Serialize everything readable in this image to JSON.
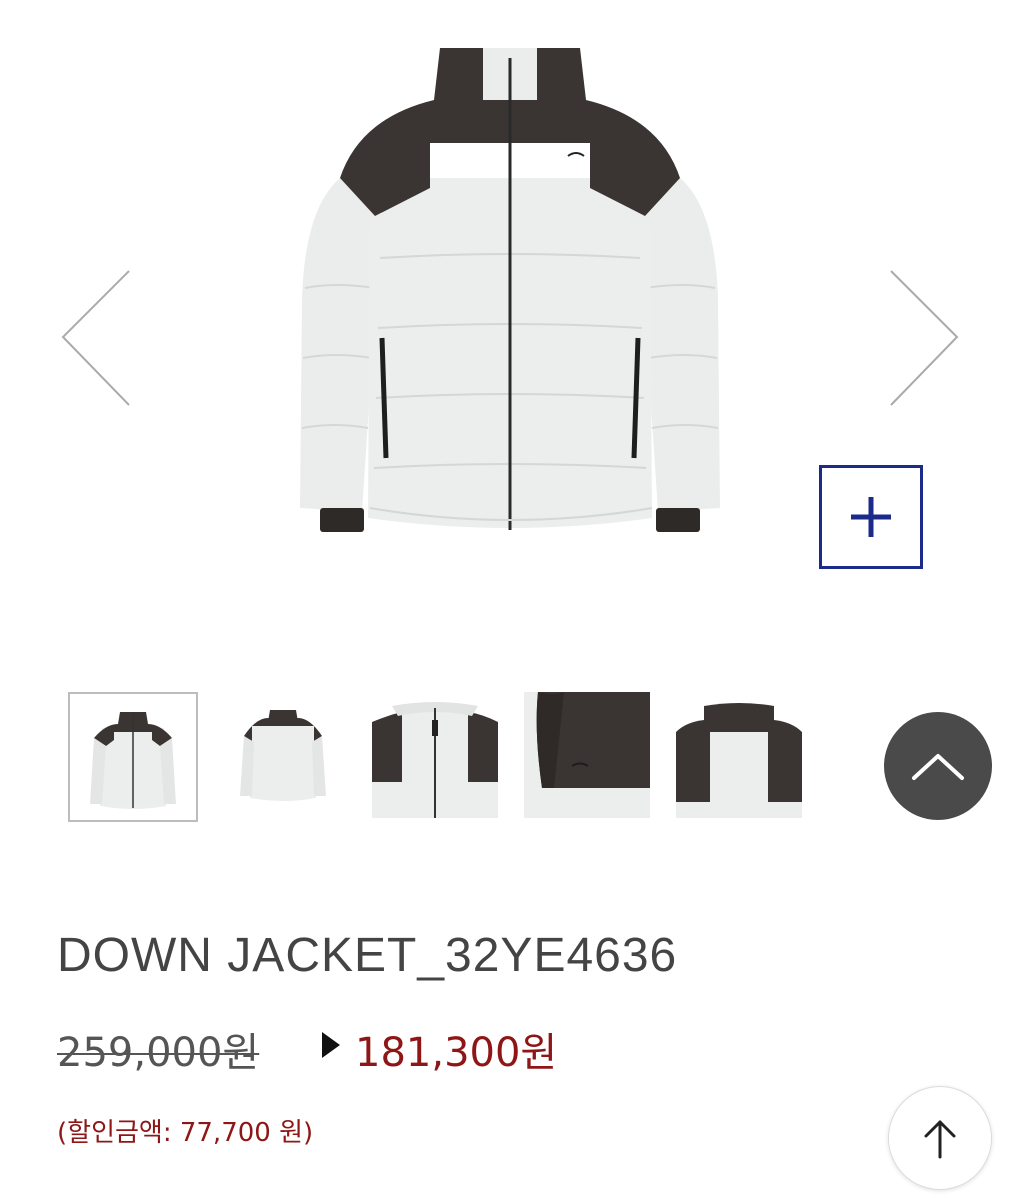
{
  "product": {
    "name": "DOWN JACKET_32YE4636",
    "original_price": "259,000원",
    "sale_price": "181,300원",
    "discount_text": "(할인금액: 77,700 원)"
  },
  "gallery": {
    "prev_icon": "chevron-left-icon",
    "next_icon": "chevron-right-icon",
    "zoom_icon": "plus-icon",
    "thumbnail_count": 5,
    "active_thumbnail": 1
  },
  "floating": {
    "scroll_up_icon": "chevron-up-icon",
    "top_icon": "arrow-up-icon"
  },
  "colors": {
    "accent_border": "#1c2a8a",
    "sale_red": "#8e1616",
    "jacket_dark": "#3a3432",
    "jacket_light": "#eceeee"
  }
}
